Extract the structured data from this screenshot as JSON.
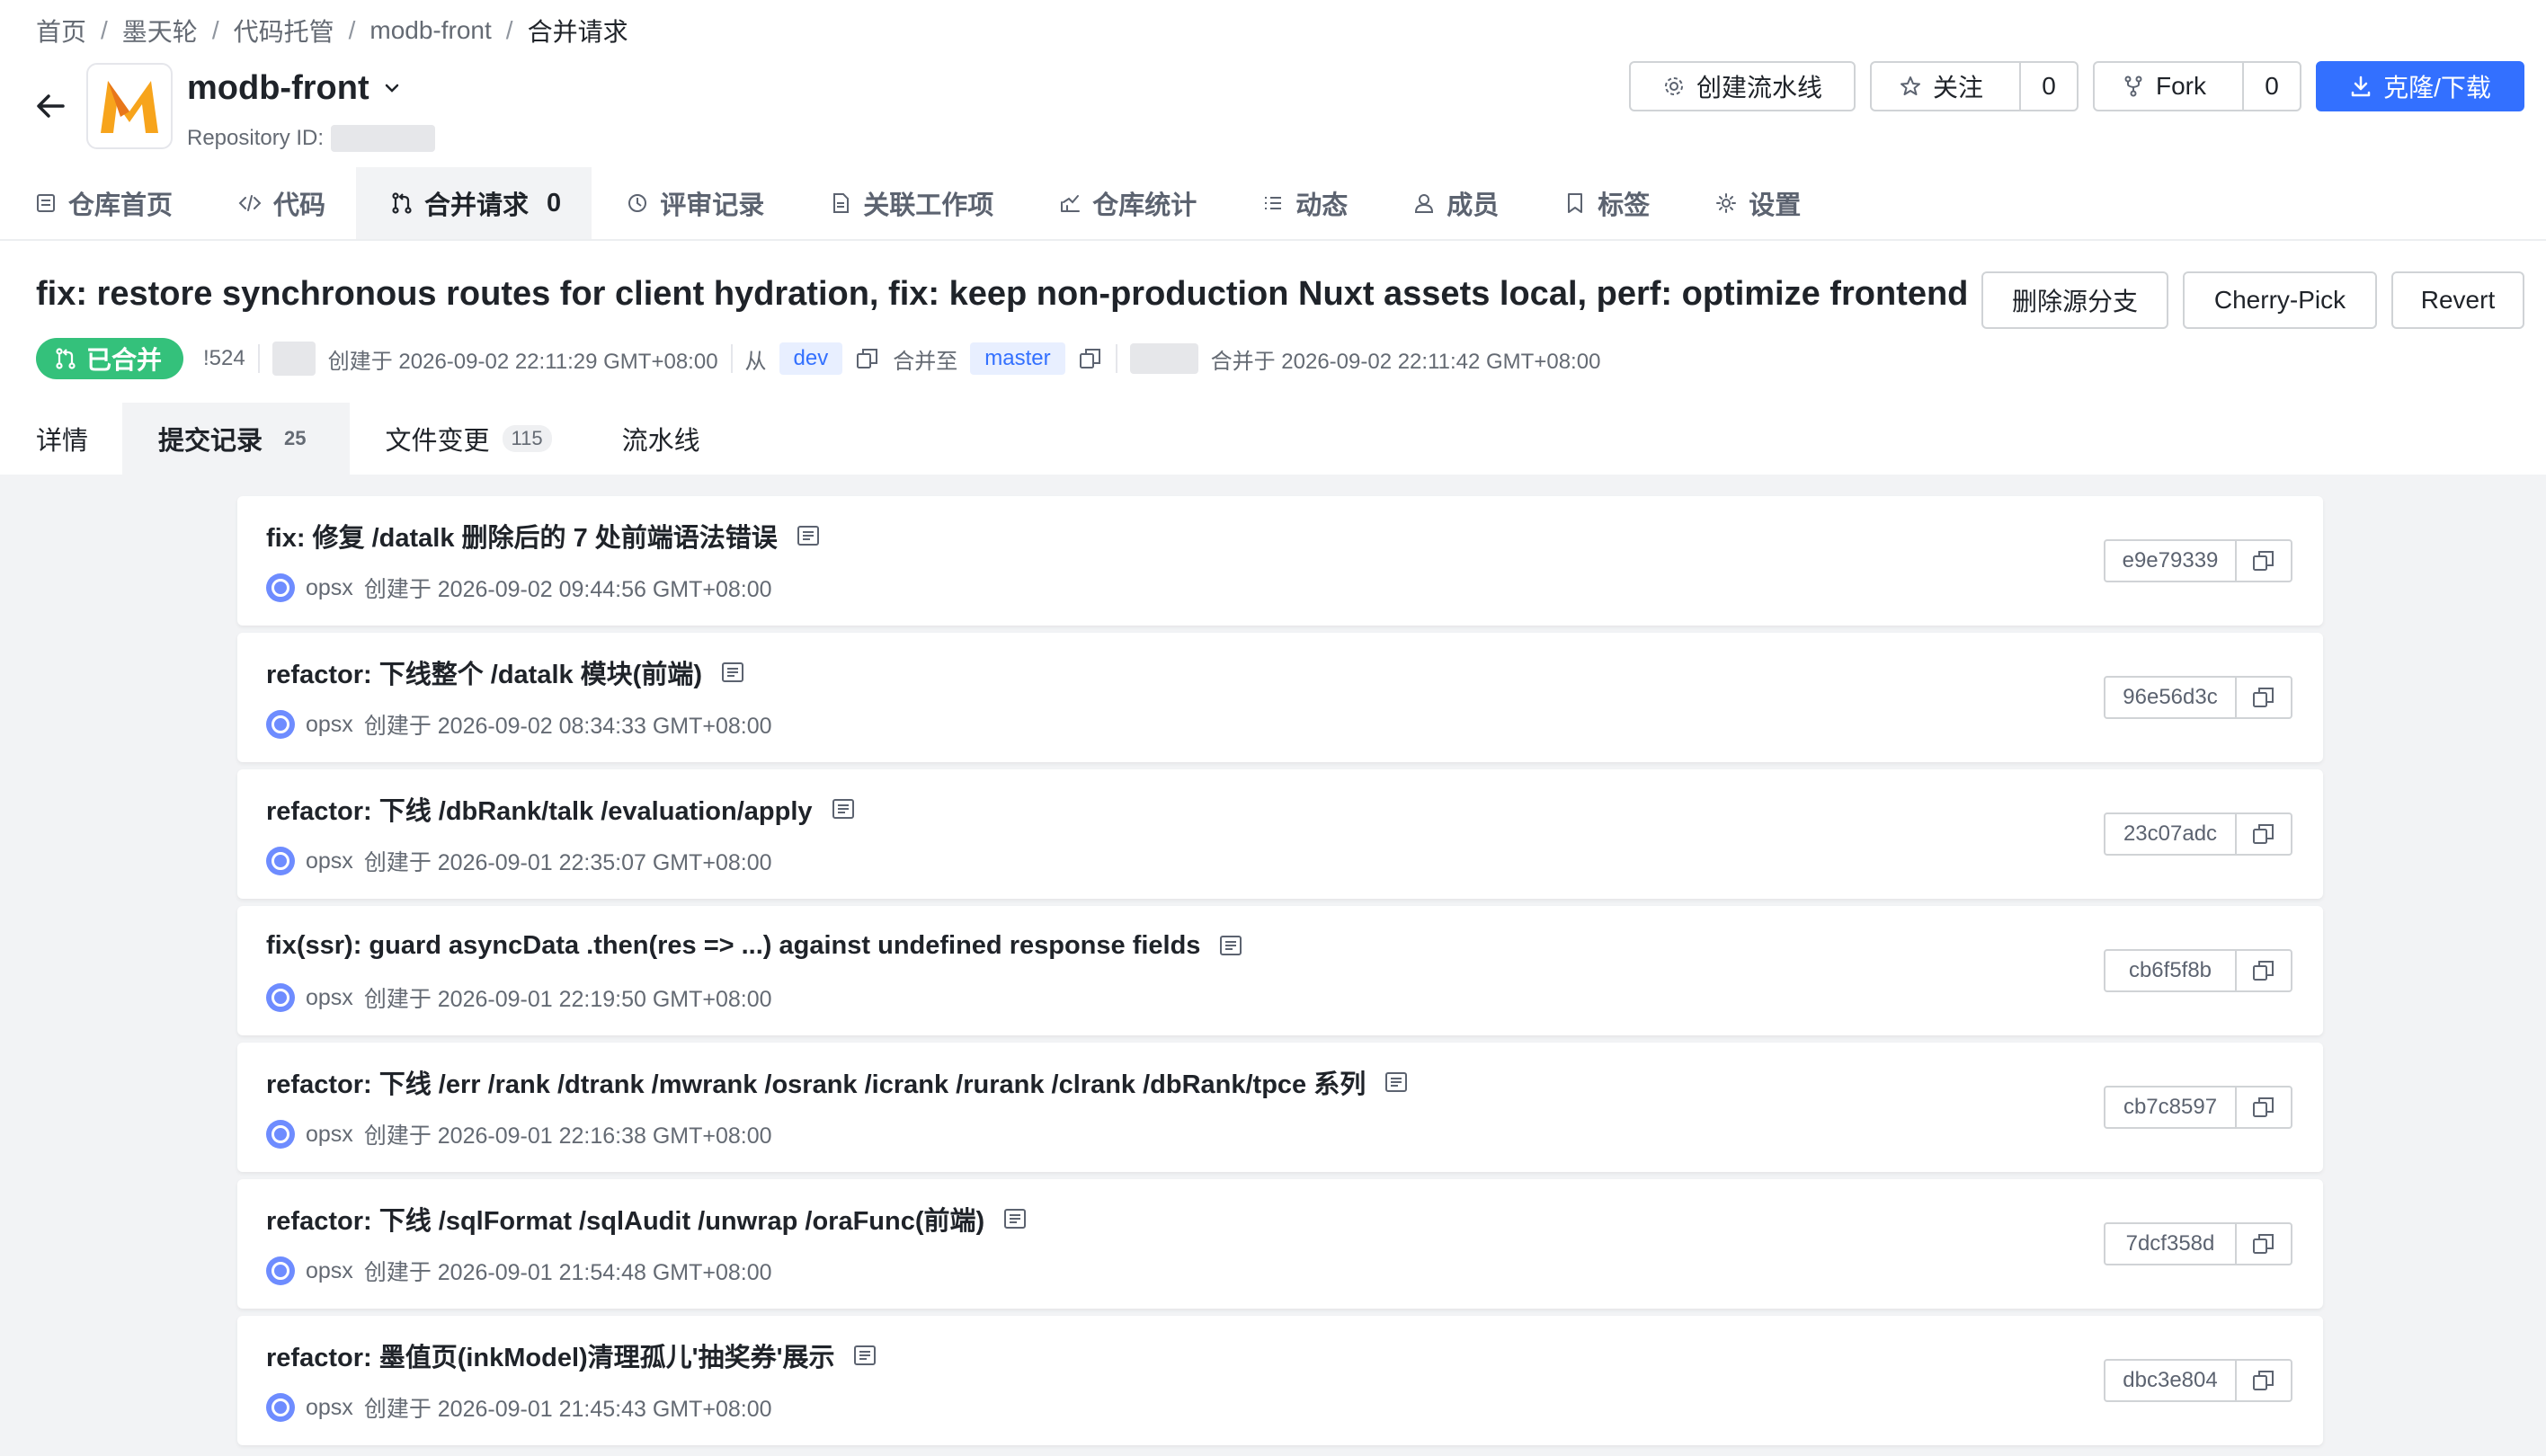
{
  "breadcrumb": [
    "首页",
    "墨天轮",
    "代码托管",
    "modb-front",
    "合并请求"
  ],
  "repo": {
    "name": "modb-front",
    "id_label": "Repository ID:"
  },
  "header_actions": {
    "pipeline": "创建流水线",
    "watch": "关注",
    "watch_count": "0",
    "fork": "Fork",
    "fork_count": "0",
    "clone": "克隆/下载"
  },
  "nav": [
    {
      "label": "仓库首页",
      "icon": "repo-home-icon"
    },
    {
      "label": "代码",
      "icon": "code-icon"
    },
    {
      "label": "合并请求",
      "icon": "merge-request-icon",
      "count": "0",
      "active": true
    },
    {
      "label": "评审记录",
      "icon": "review-icon"
    },
    {
      "label": "关联工作项",
      "icon": "workitem-icon"
    },
    {
      "label": "仓库统计",
      "icon": "stats-icon"
    },
    {
      "label": "动态",
      "icon": "activity-icon"
    },
    {
      "label": "成员",
      "icon": "member-icon"
    },
    {
      "label": "标签",
      "icon": "tag-icon"
    },
    {
      "label": "设置",
      "icon": "settings-icon"
    }
  ],
  "mr": {
    "title": "fix: restore synchronous routes for client hydration, fix: keep non-production Nuxt assets local, perf: optimize frontend buil…",
    "actions": {
      "delete_branch": "删除源分支",
      "cherry_pick": "Cherry-Pick",
      "revert": "Revert"
    },
    "status": "已合并",
    "number": "!524",
    "created": "创建于 2026-09-02 22:11:29 GMT+08:00",
    "from_label": "从",
    "source_branch": "dev",
    "merge_to_label": "合并至",
    "target_branch": "master",
    "merged": "合并于 2026-09-02 22:11:42 GMT+08:00"
  },
  "subtabs": [
    {
      "label": "详情"
    },
    {
      "label": "提交记录",
      "count": "25",
      "active": true
    },
    {
      "label": "文件变更",
      "count": "115"
    },
    {
      "label": "流水线"
    }
  ],
  "commits": [
    {
      "message": "fix: 修复 /datalk 删除后的 7 处前端语法错误",
      "author": "opsx",
      "created": "创建于 2026-09-02 09:44:56 GMT+08:00",
      "sha": "e9e79339"
    },
    {
      "message": "refactor: 下线整个 /datalk 模块(前端)",
      "author": "opsx",
      "created": "创建于 2026-09-02 08:34:33 GMT+08:00",
      "sha": "96e56d3c"
    },
    {
      "message": "refactor: 下线 /dbRank/talk /evaluation/apply",
      "author": "opsx",
      "created": "创建于 2026-09-01 22:35:07 GMT+08:00",
      "sha": "23c07adc"
    },
    {
      "message": "fix(ssr): guard asyncData .then(res => ...) against undefined response fields",
      "author": "opsx",
      "created": "创建于 2026-09-01 22:19:50 GMT+08:00",
      "sha": "cb6f5f8b"
    },
    {
      "message": "refactor: 下线 /err /rank /dtrank /mwrank /osrank /icrank /rurank /clrank /dbRank/tpce 系列",
      "author": "opsx",
      "created": "创建于 2026-09-01 22:16:38 GMT+08:00",
      "sha": "cb7c8597"
    },
    {
      "message": "refactor: 下线 /sqlFormat /sqlAudit /unwrap /oraFunc(前端)",
      "author": "opsx",
      "created": "创建于 2026-09-01 21:54:48 GMT+08:00",
      "sha": "7dcf358d"
    },
    {
      "message": "refactor: 墨值页(inkModel)清理孤儿'抽奖券'展示",
      "author": "opsx",
      "created": "创建于 2026-09-01 21:45:43 GMT+08:00",
      "sha": "dbc3e804"
    }
  ],
  "colors": {
    "accent": "#3370ff",
    "merged": "#34c17b",
    "bg": "#f2f3f5",
    "logo": "#f7a41c"
  }
}
